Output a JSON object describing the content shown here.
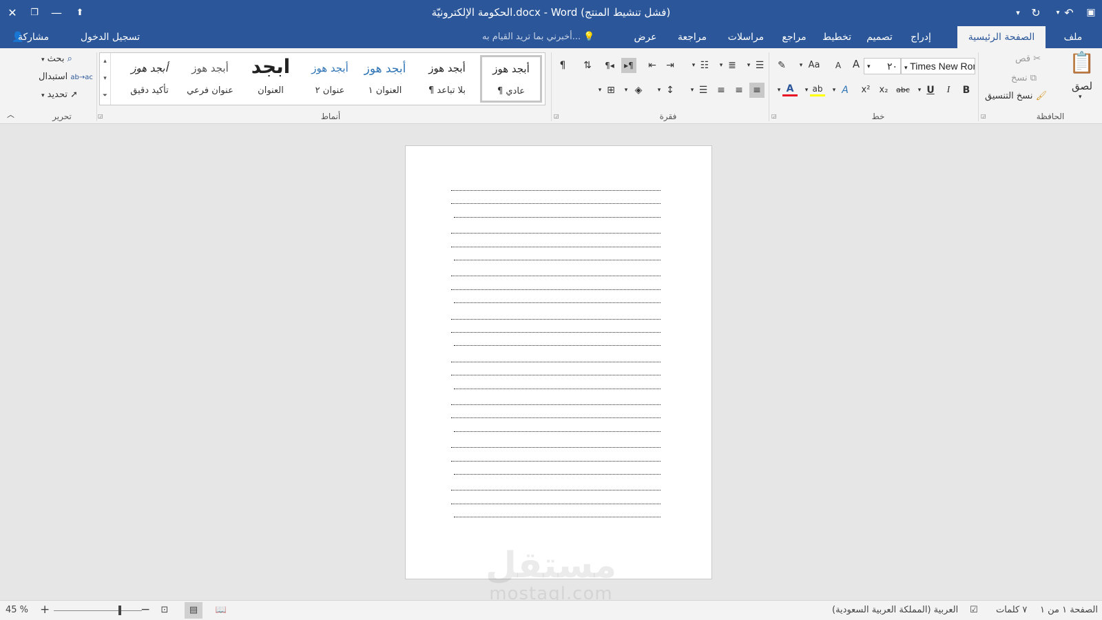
{
  "window": {
    "title": "الحكومة الإلكترونيّة.docx - Word (فشل تنشيط المنتج)",
    "close_icon": "✕",
    "restore_icon": "🗗",
    "minimize_icon": "—",
    "ribbon_options_icon": "⇪",
    "save_icon": "💾",
    "undo_icon": "↶",
    "redo_icon": "↻",
    "qat_customize_icon": "⏷"
  },
  "tabs": {
    "file": "ملف",
    "home": "الصفحة الرئيسية",
    "insert": "إدراج",
    "design": "تصميم",
    "layout": "تخطيط",
    "references": "مراجع",
    "mailings": "مراسلات",
    "review": "مراجعة",
    "view": "عرض",
    "tell_me_placeholder": "أخبرني بما تريد القيام به...",
    "sign_in": "تسجيل الدخول",
    "share": "مشاركة"
  },
  "clipboard": {
    "group_label": "الحافظة",
    "paste": "لصق",
    "cut": "قص",
    "copy": "نسخ",
    "format_painter": "نسخ التنسيق"
  },
  "font": {
    "group_label": "خط",
    "font_name": "Times New Roman",
    "font_size": "٢٠",
    "bold": "B",
    "italic": "I",
    "underline": "U",
    "strikethrough": "abc",
    "subscript": "x₂",
    "superscript": "x²",
    "grow": "A",
    "shrink": "A",
    "change_case": "Aa"
  },
  "paragraph": {
    "group_label": "فقرة",
    "pilcrow": "¶"
  },
  "styles": {
    "group_label": "أنماط",
    "items": [
      {
        "preview": "أبجد هوز",
        "name": "¶ عادي"
      },
      {
        "preview": "أبجد هوز",
        "name": "¶ بلا تباعد"
      },
      {
        "preview": "أبجد هوز",
        "name": "العنوان ١"
      },
      {
        "preview": "أبجد هوز",
        "name": "عنوان ٢"
      },
      {
        "preview": "ابجد",
        "name": "العنوان"
      },
      {
        "preview": "أبجد هوز",
        "name": "عنوان فرعي"
      },
      {
        "preview": "أبجد هوز",
        "name": "تأكيد دقيق"
      }
    ]
  },
  "editing": {
    "group_label": "تحرير",
    "find": "بحث",
    "replace": "استبدال",
    "select": "تحديد"
  },
  "document": {
    "dotted_lines": 24
  },
  "watermark": {
    "arabic": "مستقل",
    "latin": "mostaql.com"
  },
  "status": {
    "page": "الصفحة ١ من ١",
    "words": "٧ كلمات",
    "language": "العربية (المملكة العربية السعودية)",
    "zoom": "45 %",
    "zoom_in": "+",
    "zoom_out": "−"
  },
  "colors": {
    "accent": "#2b579a",
    "ribbon": "#f3f3f3",
    "canvas": "#e6e6e6",
    "font_color_bar": "#e81123",
    "highlight_bar": "#ffff00",
    "heading_blue": "#2e74b5"
  }
}
